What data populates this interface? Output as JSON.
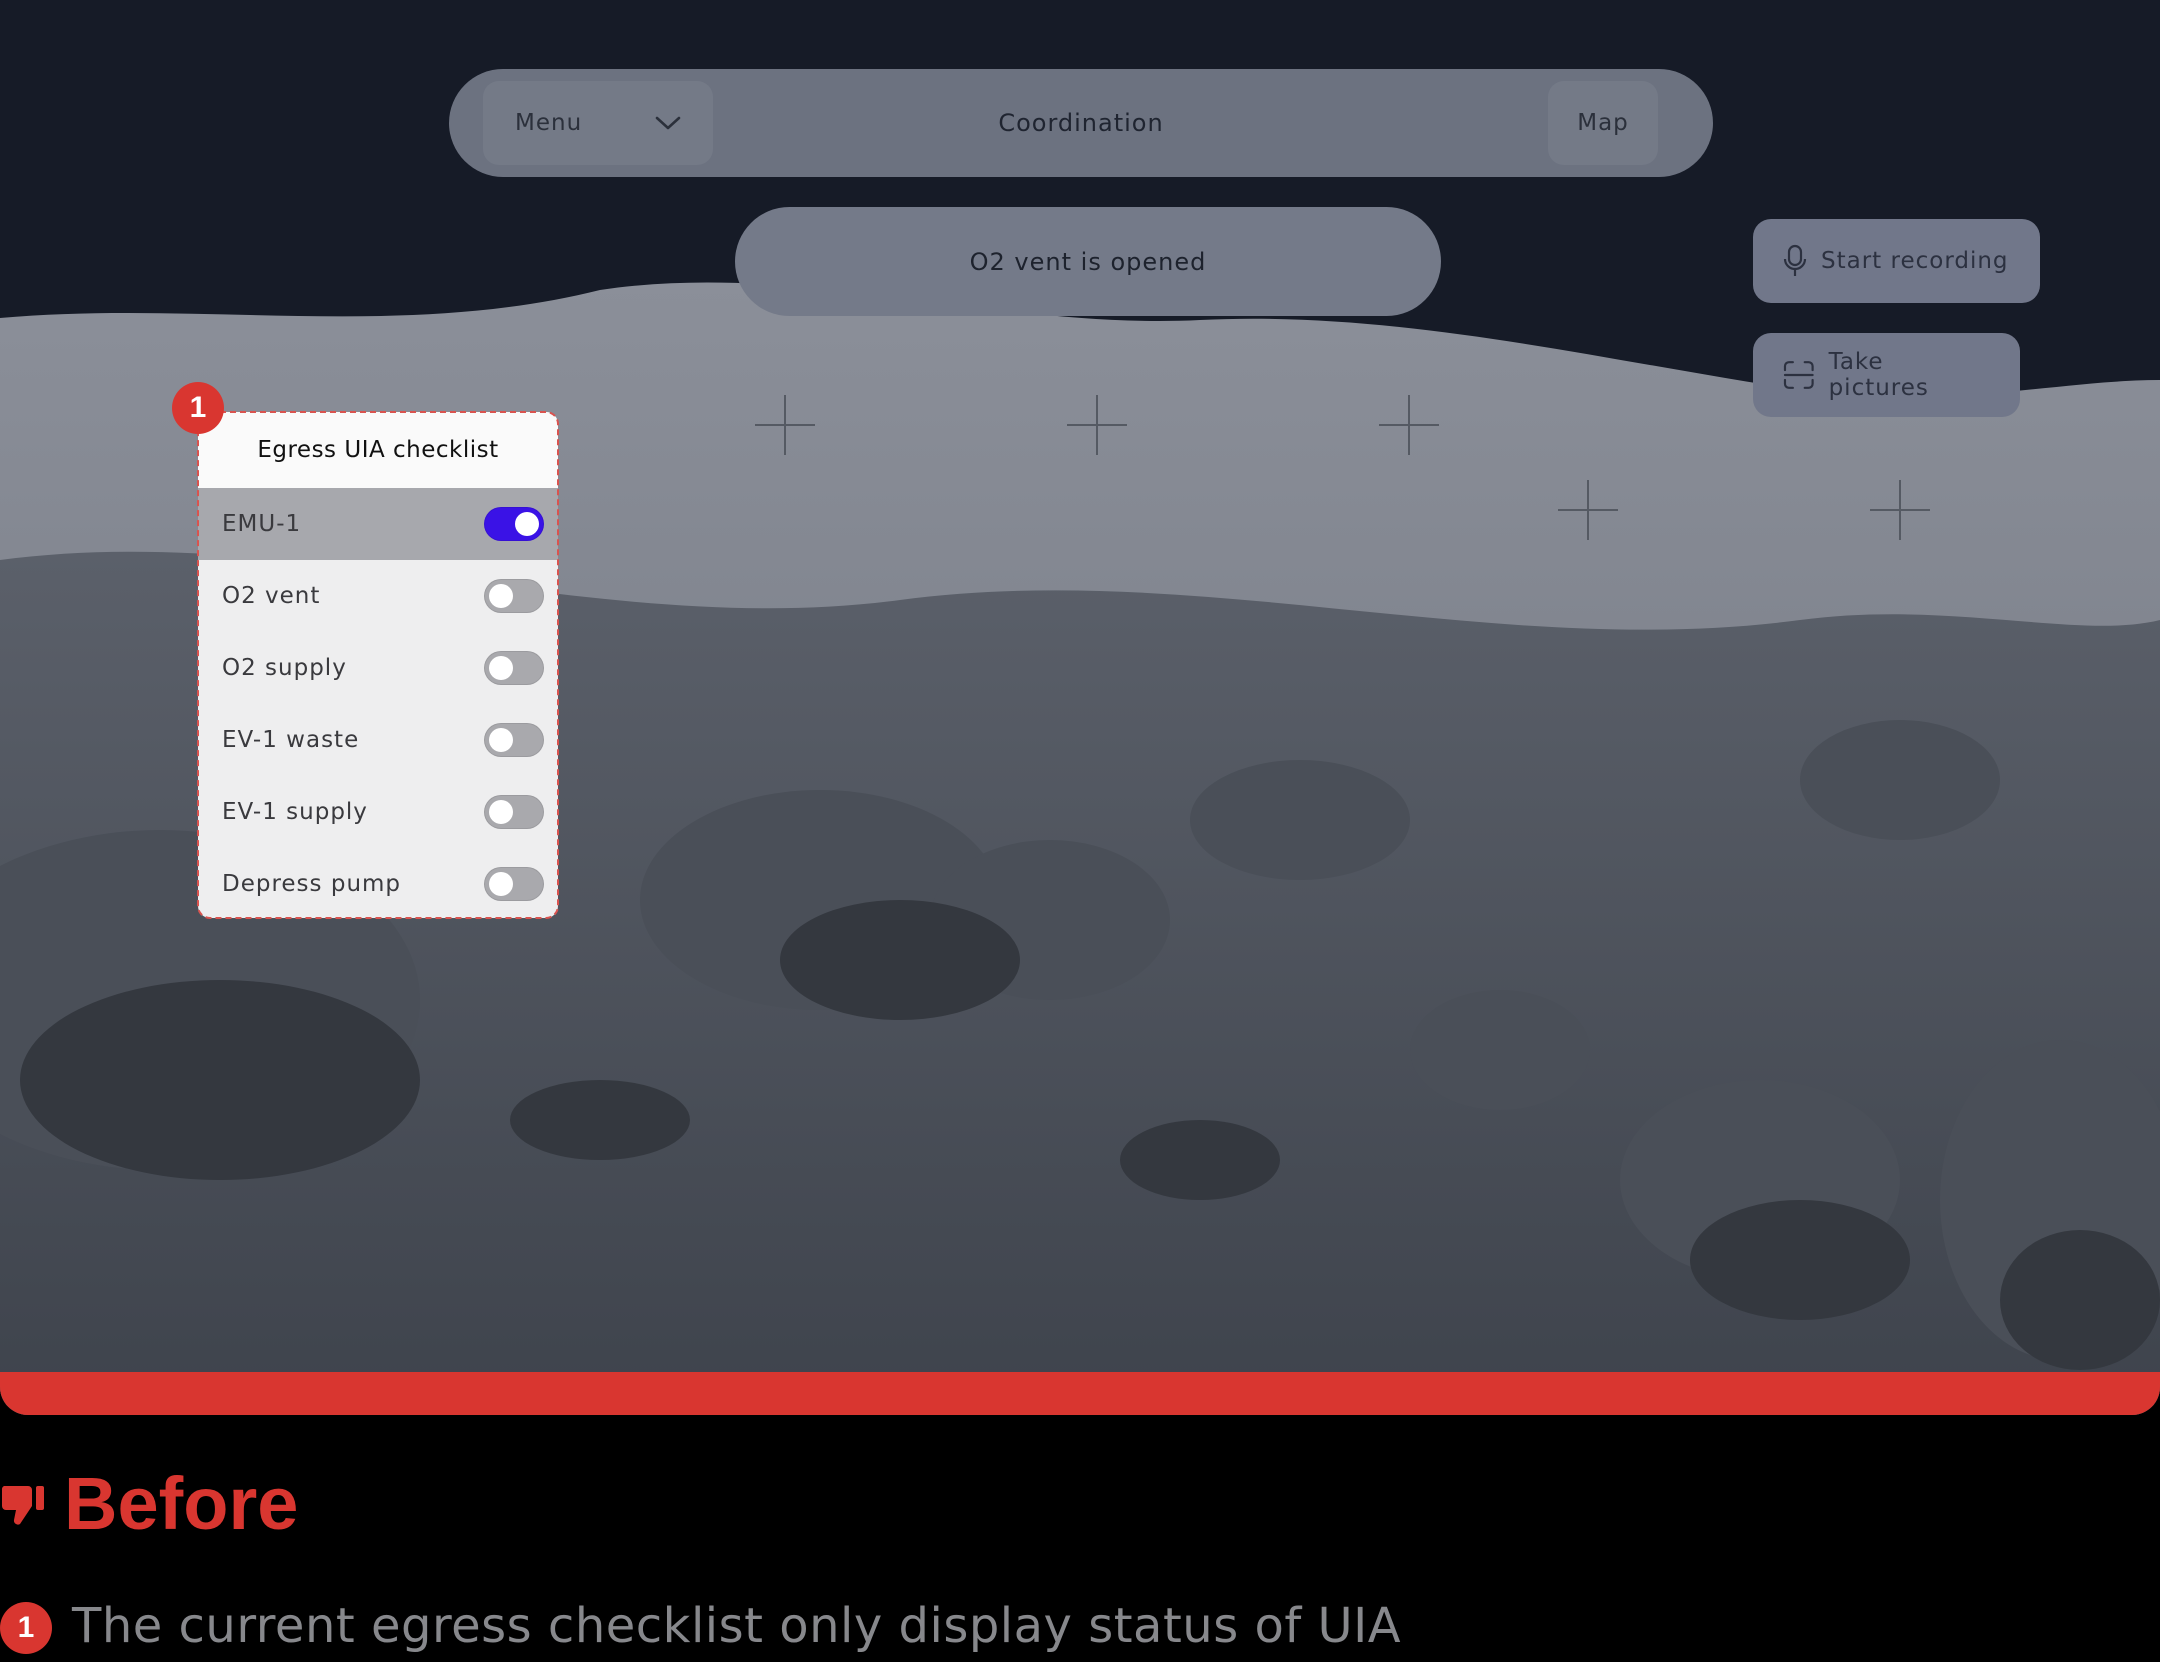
{
  "topnav": {
    "menu_label": "Menu",
    "title": "Coordination",
    "map_label": "Map"
  },
  "status": {
    "message": "O2 vent is opened"
  },
  "actions": {
    "record_label": "Start recording",
    "pictures_label": "Take pictures"
  },
  "checklist": {
    "title": "Egress UIA checklist",
    "items": [
      {
        "label": "EMU-1",
        "on": true
      },
      {
        "label": "O2 vent",
        "on": false
      },
      {
        "label": "O2 supply",
        "on": false
      },
      {
        "label": "EV-1 waste",
        "on": false
      },
      {
        "label": "EV-1 supply",
        "on": false
      },
      {
        "label": "Depress pump",
        "on": false
      }
    ]
  },
  "annotation": {
    "badge_number": "1",
    "heading": "Before",
    "notes": [
      {
        "number": "1",
        "text": "The current egress checklist only display status of UIA"
      }
    ]
  },
  "colors": {
    "accent_red": "#d93630",
    "toggle_on": "#3a12e6",
    "sky": "#161b27"
  }
}
